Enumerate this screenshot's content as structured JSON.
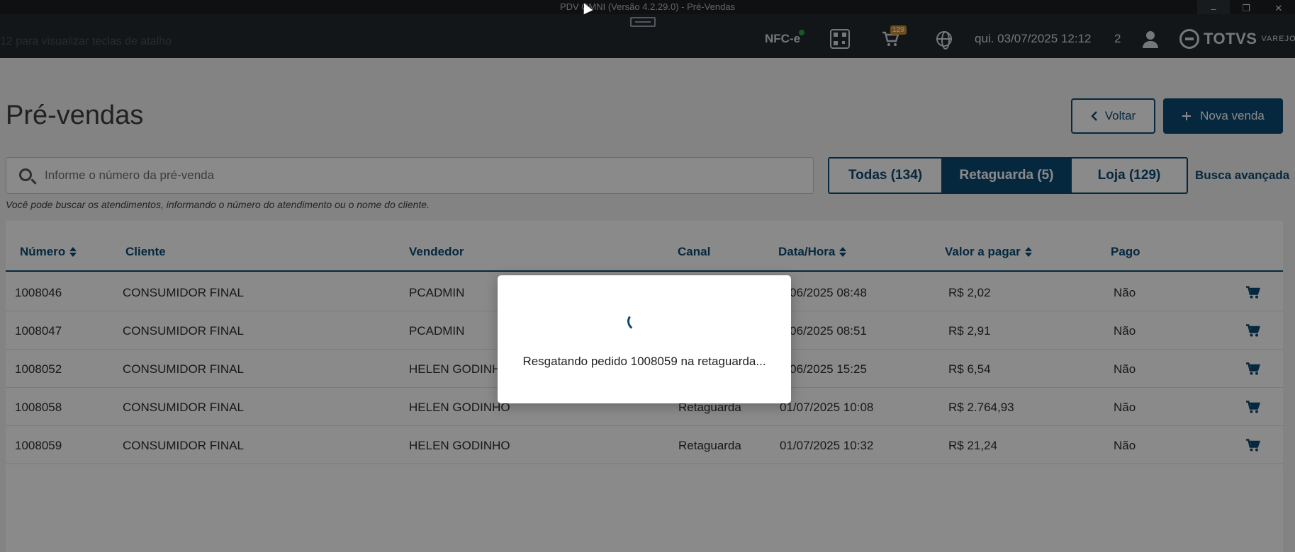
{
  "window": {
    "title": "PDV OMNI (Versão 4.2.29.0) - Pré-Vendas",
    "buttons": [
      "–",
      "❐",
      "✕"
    ]
  },
  "topbar": {
    "shortcut_hint": "12 para visualizar teclas de atalho",
    "nfce_label": "NFC-e",
    "cart_badge": "129",
    "datetime": "qui. 03/07/2025 12:12",
    "user_count": "2",
    "brand": "TOTVS",
    "brand_sub": "VAREJO",
    "icons": [
      "qr-code-icon",
      "cart-icon",
      "globe-icon",
      "user-icon"
    ]
  },
  "page": {
    "title": "Pré-vendas",
    "back_label": "Voltar",
    "new_sale_label": "Nova venda",
    "search_placeholder": "Informe o número da pré-venda",
    "search_help": "Você pode buscar os atendimentos, informando o número do atendimento ou o nome do cliente.",
    "filters": [
      {
        "label": "Todas (134)",
        "active": false
      },
      {
        "label": "Retaguarda (5)",
        "active": true
      },
      {
        "label": "Loja (129)",
        "active": false
      }
    ],
    "advanced_search": "Busca avançada"
  },
  "table": {
    "columns": [
      "Número",
      "Cliente",
      "Vendedor",
      "Canal",
      "Data/Hora",
      "Valor a pagar",
      "Pago"
    ],
    "rows": [
      {
        "numero": "1008046",
        "cliente": "CONSUMIDOR FINAL",
        "vendedor": "PCADMIN",
        "canal": "",
        "data": "7/06/2025 08:48",
        "valor": "R$ 2,02",
        "pago": "Não"
      },
      {
        "numero": "1008047",
        "cliente": "CONSUMIDOR FINAL",
        "vendedor": "PCADMIN",
        "canal": "",
        "data": "7/06/2025 08:51",
        "valor": "R$ 2,91",
        "pago": "Não"
      },
      {
        "numero": "1008052",
        "cliente": "CONSUMIDOR FINAL",
        "vendedor": "HELEN GODINHO",
        "canal": "",
        "data": "0/06/2025 15:25",
        "valor": "R$ 6,54",
        "pago": "Não"
      },
      {
        "numero": "1008058",
        "cliente": "CONSUMIDOR FINAL",
        "vendedor": "HELEN GODINHO",
        "canal": "Retaguarda",
        "data": "01/07/2025 10:08",
        "valor": "R$ 2.764,93",
        "pago": "Não"
      },
      {
        "numero": "1008059",
        "cliente": "CONSUMIDOR FINAL",
        "vendedor": "HELEN GODINHO",
        "canal": "Retaguarda",
        "data": "01/07/2025 10:32",
        "valor": "R$ 21,24",
        "pago": "Não"
      }
    ]
  },
  "modal": {
    "message": "Resgatando pedido 1008059 na retaguarda..."
  },
  "colors": {
    "primary": "#0c4a73",
    "topbar": "#24292d",
    "titlebar": "#1b1e21",
    "overlay": "rgba(0,0,0,0.46)"
  }
}
